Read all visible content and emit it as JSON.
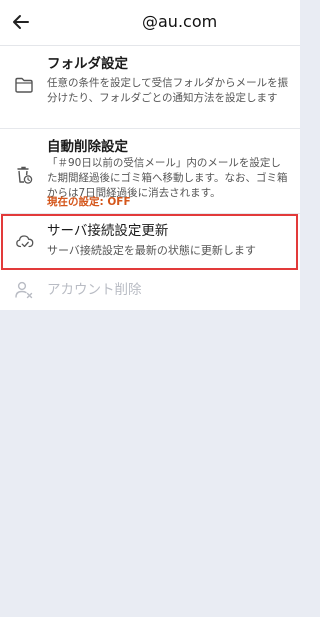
{
  "header": {
    "email_domain": "@au.com",
    "back_icon": "arrow-left-icon"
  },
  "menu": {
    "folder": {
      "title": "フォルダ設定",
      "description": "任意の条件を設定して受信フォルダからメールを振分けたり、フォルダごとの通知方法を設定します",
      "icon": "folder-icon"
    },
    "auto_delete": {
      "title": "自動削除設定",
      "description": "「＃90日以前の受信メール」内のメールを設定した期間経過後にゴミ箱へ移動します。なお、ゴミ箱からは7日間経過後に消去されます。",
      "status": "現在の設定: OFF",
      "icon": "trash-clock-icon",
      "status_color": "#d4561b"
    },
    "server_sync": {
      "title": "サーバ接続設定更新",
      "description": "サーバ接続設定を最新の状態に更新します",
      "icon": "cloud-check-icon",
      "highlight_color": "#e23a3a"
    },
    "delete_account": {
      "title": "アカウント削除",
      "icon": "user-remove-icon",
      "disabled": true
    }
  }
}
